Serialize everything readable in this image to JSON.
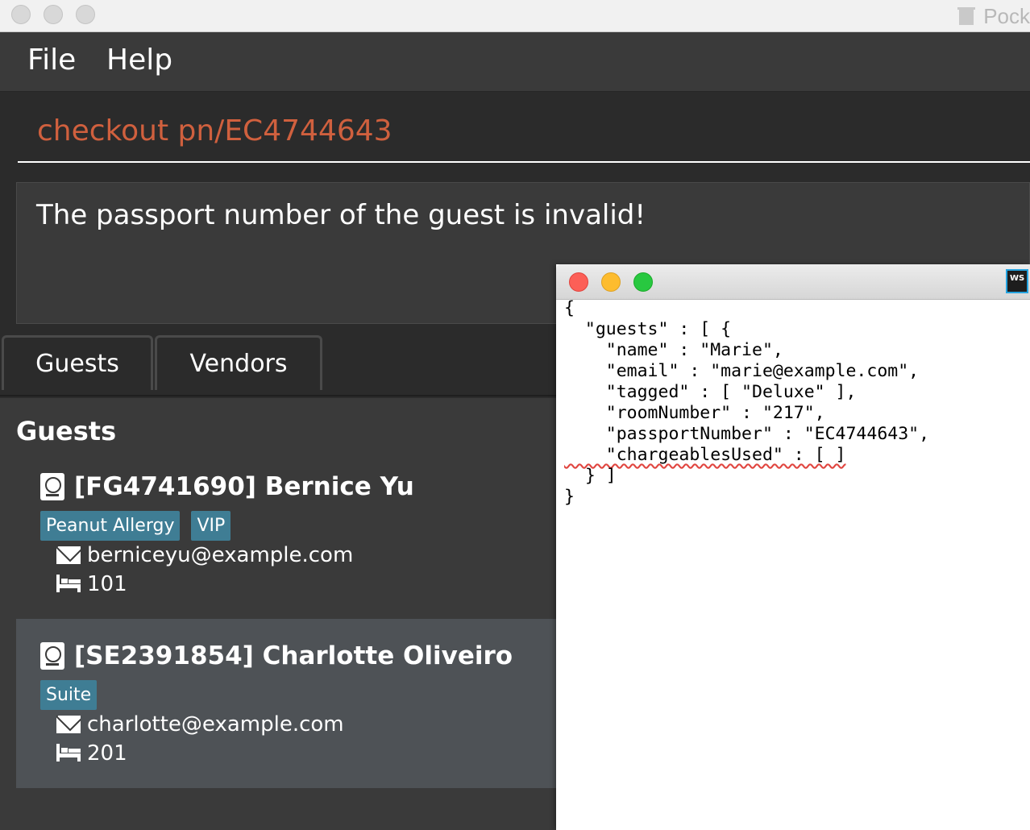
{
  "titlebar": {
    "title": "Pock"
  },
  "menubar": {
    "items": [
      "File",
      "Help"
    ]
  },
  "command_box": {
    "text": "checkout pn/EC4744643"
  },
  "result_box": {
    "text": "The passport number of the guest is invalid!"
  },
  "tabs": [
    {
      "label": "Guests"
    },
    {
      "label": "Vendors"
    }
  ],
  "list": {
    "title": "Guests",
    "cards": [
      {
        "header": "[FG4741690] Bernice Yu",
        "tags": [
          "Peanut Allergy",
          "VIP"
        ],
        "email": "berniceyu@example.com",
        "room": "101"
      },
      {
        "header": "[SE2391854] Charlotte Oliveiro",
        "tags": [
          "Suite"
        ],
        "email": "charlotte@example.com",
        "room": "201"
      }
    ]
  },
  "json_window": {
    "icon": "WS",
    "lines": [
      "{",
      "  \"guests\" : [ {",
      "    \"name\" : \"Marie\",",
      "    \"email\" : \"marie@example.com\",",
      "    \"tagged\" : [ \"Deluxe\" ],",
      "    \"roomNumber\" : \"217\",",
      "    \"passportNumber\" : \"EC4744643\",",
      "    \"chargeablesUsed\" : [ ]",
      "  } ]",
      "}"
    ]
  },
  "colors": {
    "command_text": "#d0603e",
    "tag_bg": "#3f7d94",
    "traffic_close": "#fc5f57",
    "traffic_min": "#fdbc2e",
    "traffic_max": "#28c840"
  }
}
